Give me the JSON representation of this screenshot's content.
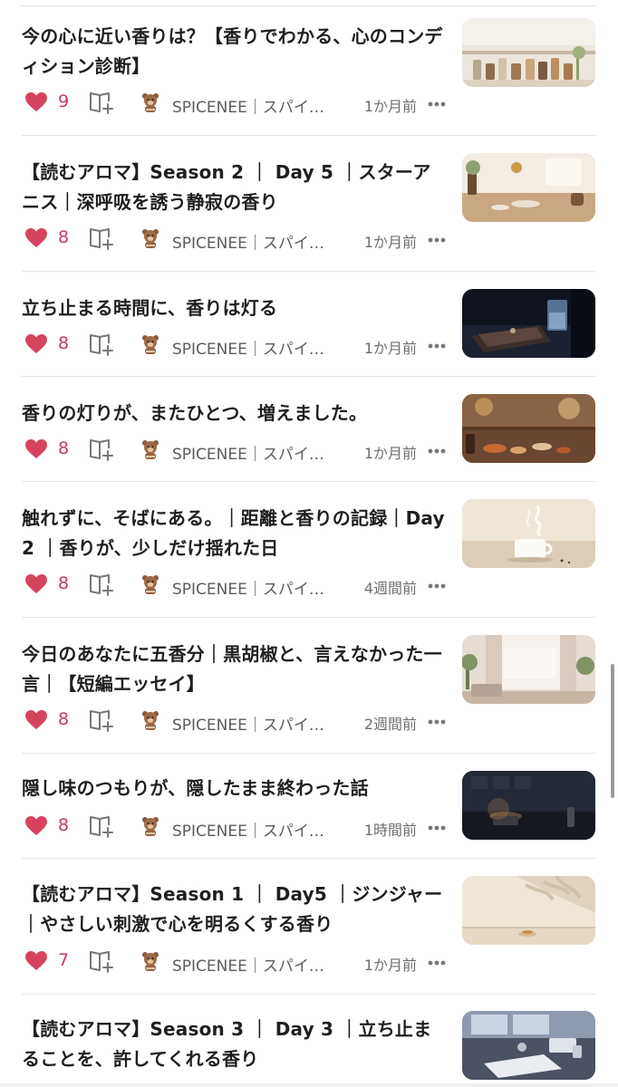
{
  "articles": [
    {
      "title": "今の心に近い香りは？【香りでわかる、心のコンディション診断】",
      "likes": "9",
      "creator": "SPICENEE｜スパイ…",
      "time": "1か月前",
      "thumbnail_icon": "kitchen-shelf-spice-jars-image"
    },
    {
      "title": "【読むアロマ】Season 2 ｜ Day 5 ｜スターアニス｜深呼吸を誘う静寂の香り",
      "likes": "8",
      "creator": "SPICENEE｜スパイ…",
      "time": "1か月前",
      "thumbnail_icon": "sunlit-kitchen-counter-image"
    },
    {
      "title": "立ち止まる時間に、香りは灯る",
      "likes": "8",
      "creator": "SPICENEE｜スパイ…",
      "time": "1か月前",
      "thumbnail_icon": "dark-table-glass-notebook-image"
    },
    {
      "title": "香りの灯りが、またひとつ、増えました。",
      "likes": "8",
      "creator": "SPICENEE｜スパイ…",
      "time": "1か月前",
      "thumbnail_icon": "warm-table-spice-bowls-image"
    },
    {
      "title": "触れずに、そばにある。｜距離と香りの記録｜Day 2 ｜香りが、少しだけ揺れた日",
      "likes": "8",
      "creator": "SPICENEE｜スパイ…",
      "time": "4週間前",
      "thumbnail_icon": "steaming-white-cup-image"
    },
    {
      "title": "今日のあなたに五香分｜黒胡椒と、言えなかった一言｜【短編エッセイ】",
      "likes": "8",
      "creator": "SPICENEE｜スパイ…",
      "time": "2週間前",
      "thumbnail_icon": "bright-room-curtains-image"
    },
    {
      "title": "隠し味のつもりが、隠したまま終わった話",
      "likes": "8",
      "creator": "SPICENEE｜スパイ…",
      "time": "1時間前",
      "thumbnail_icon": "dark-kitchen-night-image"
    },
    {
      "title": "【読むアロマ】Season 1 ｜ Day5 ｜ジンジャー｜やさしい刺激で心を明るくする香り",
      "likes": "7",
      "creator": "SPICENEE｜スパイ…",
      "time": "1か月前",
      "thumbnail_icon": "leaf-shadow-wall-image"
    },
    {
      "title": "【読むアロマ】Season 3 ｜ Day 3 ｜立ち止まることを、許してくれる香り",
      "likes": "",
      "creator": "",
      "time": "",
      "thumbnail_icon": "desk-window-book-image"
    }
  ],
  "icons": {
    "like": "heart-icon",
    "magazine": "add-to-magazine-icon",
    "creator": "bear-avatar-icon",
    "more": "more-options-icon"
  },
  "colors": {
    "like_accent": "#d6435f",
    "like_count": "#c43c5d",
    "text_primary": "#1f1f1f",
    "text_secondary": "#5c5c5c",
    "divider": "#e6e6e6"
  }
}
